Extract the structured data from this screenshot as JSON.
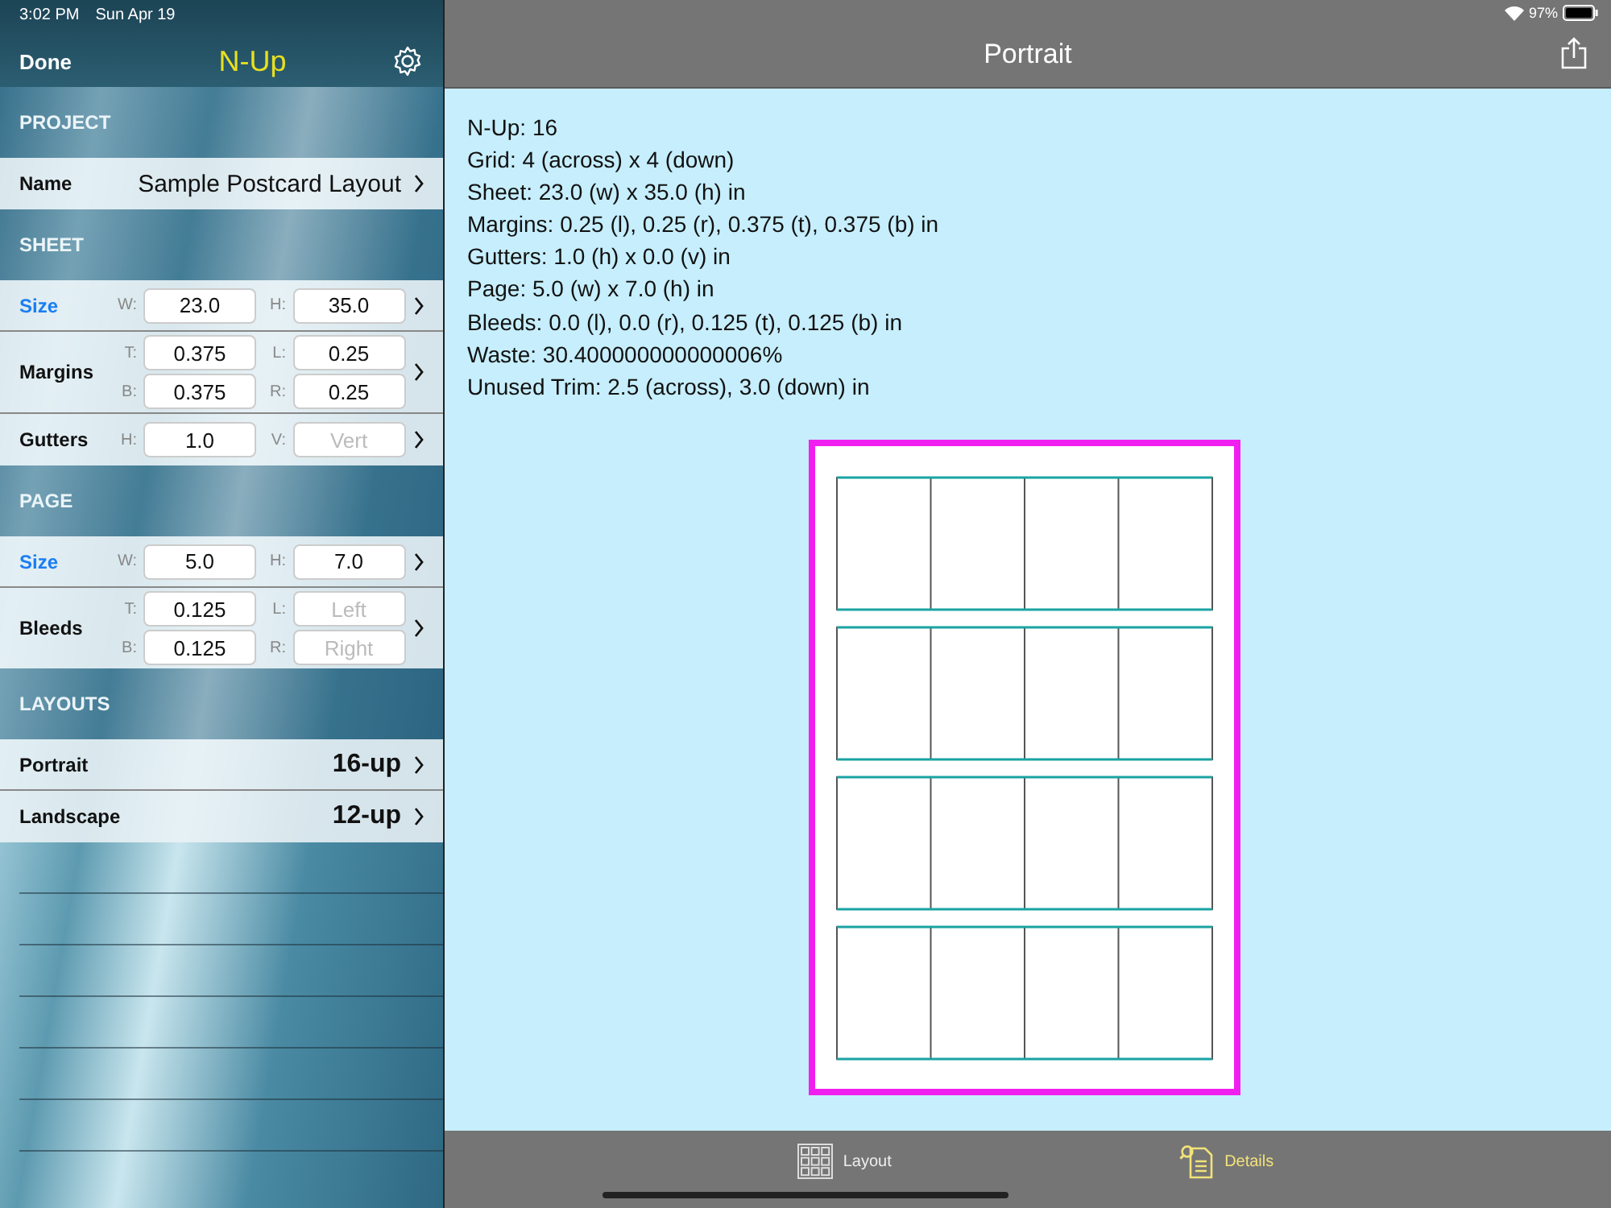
{
  "status_bar": {
    "time": "3:02 PM",
    "date": "Sun Apr 19",
    "battery": "97%"
  },
  "sidebar": {
    "done": "Done",
    "title": "N-Up",
    "sections": [
      {
        "header": "PROJECT",
        "rows": [
          {
            "kind": "text",
            "label": "Name",
            "selected": false,
            "value": "Sample Postcard Layout"
          }
        ]
      },
      {
        "header": "SHEET",
        "rows": [
          {
            "kind": "fields",
            "label": "Size",
            "selected": true,
            "fields": [
              {
                "prefix": "W:",
                "value": "23.0"
              },
              {
                "prefix": "H:",
                "value": "35.0"
              }
            ]
          },
          {
            "kind": "fields",
            "label": "Margins",
            "selected": false,
            "fields": [
              {
                "prefix": "T:",
                "value": "0.375"
              },
              {
                "prefix": "L:",
                "value": "0.25"
              },
              {
                "prefix": "B:",
                "value": "0.375"
              },
              {
                "prefix": "R:",
                "value": "0.25"
              }
            ]
          },
          {
            "kind": "fields",
            "label": "Gutters",
            "selected": false,
            "fields": [
              {
                "prefix": "H:",
                "value": "1.0"
              },
              {
                "prefix": "V:",
                "placeholder": "Vert"
              }
            ]
          }
        ]
      },
      {
        "header": "PAGE",
        "rows": [
          {
            "kind": "fields",
            "label": "Size",
            "selected": true,
            "fields": [
              {
                "prefix": "W:",
                "value": "5.0"
              },
              {
                "prefix": "H:",
                "value": "7.0"
              }
            ]
          },
          {
            "kind": "fields",
            "label": "Bleeds",
            "selected": false,
            "fields": [
              {
                "prefix": "T:",
                "value": "0.125"
              },
              {
                "prefix": "L:",
                "placeholder": "Left"
              },
              {
                "prefix": "B:",
                "value": "0.125"
              },
              {
                "prefix": "R:",
                "placeholder": "Right"
              }
            ]
          }
        ]
      },
      {
        "header": "LAYOUTS",
        "rows": [
          {
            "kind": "layout",
            "label": "Portrait",
            "selected": false,
            "value": "16-up"
          },
          {
            "kind": "layout",
            "label": "Landscape",
            "selected": false,
            "value": "12-up"
          }
        ]
      }
    ]
  },
  "detail": {
    "title": "Portrait",
    "lines": [
      "N-Up: 16",
      "Grid: 4 (across) x 4 (down)",
      "Sheet: 23.0 (w) x 35.0 (h) in",
      "Margins: 0.25 (l), 0.25 (r), 0.375 (t), 0.375 (b) in",
      "Gutters: 1.0 (h) x 0.0 (v) in",
      "Page: 5.0 (w) x 7.0 (h) in",
      "Bleeds: 0.0 (l), 0.0 (r), 0.125 (t), 0.125 (b) in",
      "Waste: 30.400000000000006%",
      "Unused Trim: 2.5 (across), 3.0 (down) in"
    ]
  },
  "tabs": [
    {
      "label": "Layout",
      "selected": false
    },
    {
      "label": "Details",
      "selected": true
    }
  ]
}
